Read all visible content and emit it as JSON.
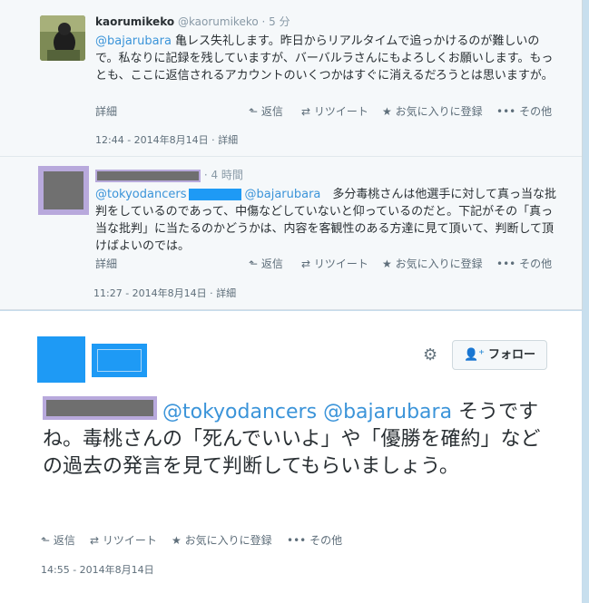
{
  "tweets": [
    {
      "name": "kaorumikeko",
      "handle": "@kaorumikeko",
      "time": "· 5 分",
      "mention": "@bajarubara",
      "text": " 亀レス失礼します。昨日からリアルタイムで追っかけるのが難しいので。私なりに記録を残していますが、バーバルラさんにもよろしくお願いします。もっとも、ここに返信されるアカウントのいくつかはすぐに消えるだろうとは思いますが。",
      "detail_link": "詳細",
      "timestamp": "12:44 - 2014年8月14日 · 詳細"
    },
    {
      "time": "· 4 時間",
      "mention1": "@tokyodancers",
      "mention2": "@bajarubara",
      "text": "多分毒桃さんは他選手に対して真っ当な批判をしているのであって、中傷などしていないと仰っているのだと。下記がその「真っ当な批判」に当たるのかどうかは、内容を客観性のある方達に見て頂いて、判断して頂けばよいのでは。",
      "detail_link": "詳細",
      "timestamp": "11:27 - 2014年8月14日 · 詳細"
    }
  ],
  "actions": {
    "reply": "返信",
    "retweet": "リツイート",
    "favorite": "お気に入りに登録",
    "more": "その他"
  },
  "icons": {
    "reply": "reply-arrow-icon",
    "retweet": "retweet-icon",
    "favorite": "star-icon",
    "more": "ellipsis-icon",
    "settings": "gear-icon",
    "follow": "add-user-icon"
  },
  "focal": {
    "follow_label": "フォロー",
    "mention1": "@tokyodancers",
    "mention2": "@bajarubara",
    "text": " そうですね。毒桃さんの「死んでいいよ」や「優勝を確約」などの過去の発言を見て判断してもらいましょう。",
    "timestamp": "14:55 - 2014年8月14日"
  },
  "colors": {
    "link": "#3b94d9",
    "redaction_blue": "#1e9af5",
    "redaction_gray": "#6f6f6f",
    "redaction_border": "#b8a9dc"
  }
}
